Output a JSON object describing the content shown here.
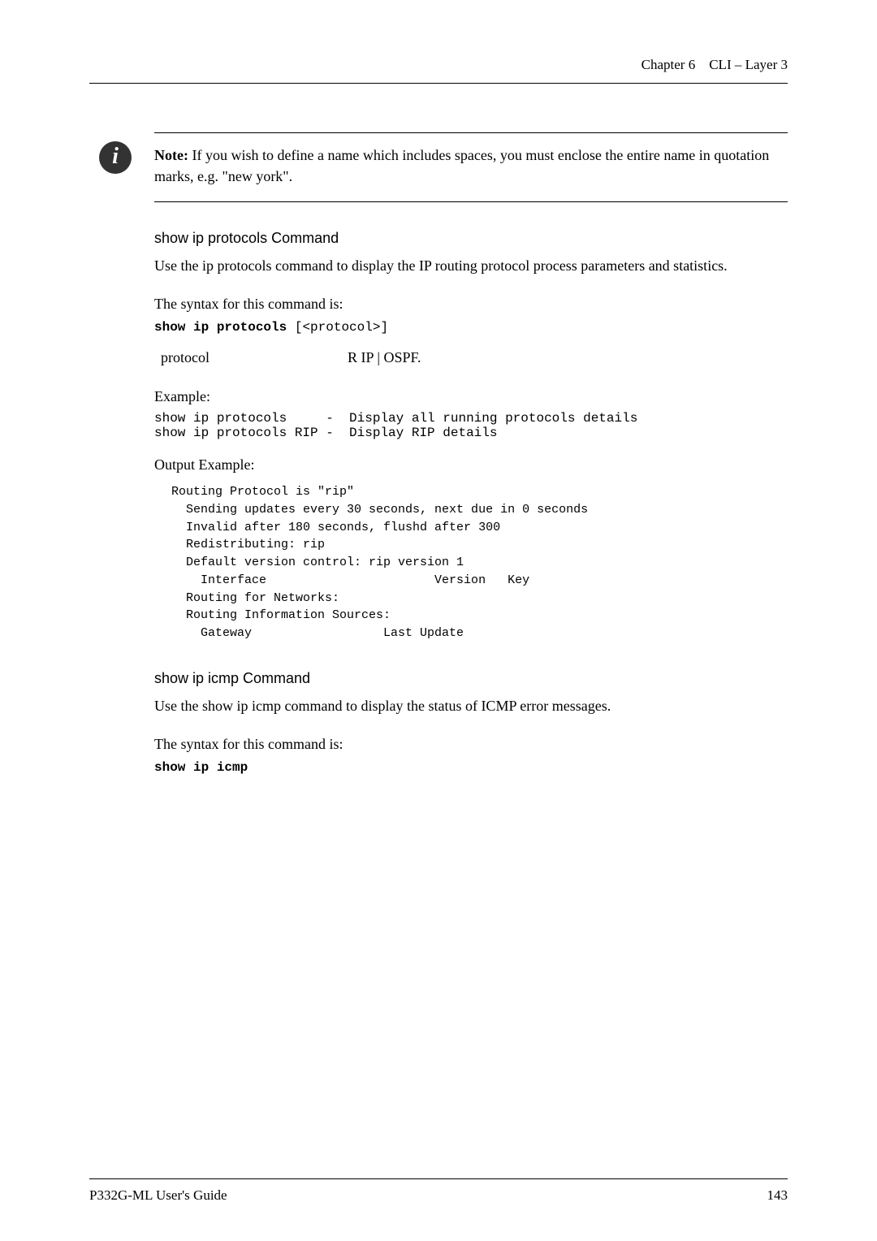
{
  "header": {
    "chapter_label": "Chapter 6",
    "chapter_title": "CLI – Layer 3"
  },
  "note": {
    "prefix": "Note:",
    "text": "If you wish to define a name which includes spaces, you must enclose the entire name in quotation marks, e.g. \"new york\"."
  },
  "section1": {
    "title": "show ip protocols Command",
    "desc": "Use the ip protocols command to display the IP routing protocol process parameters and statistics.",
    "syntax_intro": "The syntax for this command is:",
    "syntax_bold": "show ip protocols",
    "syntax_rest": " [<protocol>]",
    "param_name": "protocol",
    "param_desc": "R IP | OSPF.",
    "example_label": "Example:",
    "example_line1": "show ip protocols     -  Display all running protocols details",
    "example_line2": "show ip protocols RIP -  Display RIP details",
    "output_label": "Output Example:",
    "output_text": " Routing Protocol is \"rip\"\n   Sending updates every 30 seconds, next due in 0 seconds\n   Invalid after 180 seconds, flushd after 300\n   Redistributing: rip\n   Default version control: rip version 1\n     Interface                       Version   Key\n   Routing for Networks:\n   Routing Information Sources:\n     Gateway                  Last Update"
  },
  "section2": {
    "title": "show ip icmp Command",
    "desc": "Use the show ip icmp command to display the status of ICMP error messages.",
    "syntax_intro": "The syntax for this command is:",
    "syntax_bold": "show ip icmp"
  },
  "footer": {
    "left": "P332G-ML User's Guide",
    "right": "143"
  }
}
